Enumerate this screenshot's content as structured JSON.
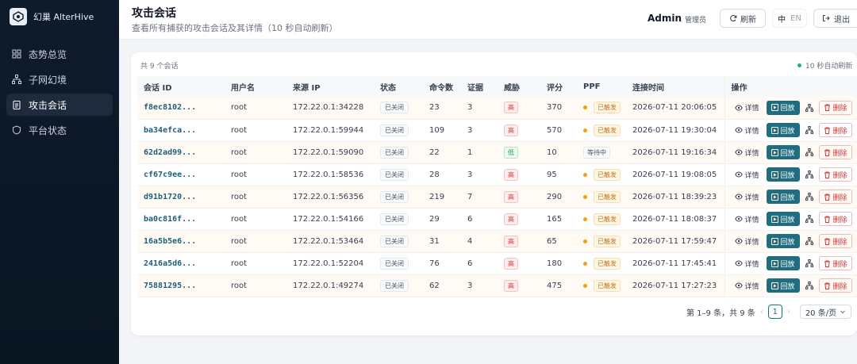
{
  "brand": {
    "name": "幻巢 AlterHive"
  },
  "sidebar": {
    "items": [
      {
        "label": "态势总览",
        "icon": "dashboard-icon",
        "active": false
      },
      {
        "label": "子网幻境",
        "icon": "network-icon",
        "active": false
      },
      {
        "label": "攻击会话",
        "icon": "clipboard-icon",
        "active": true
      },
      {
        "label": "平台状态",
        "icon": "shield-icon",
        "active": false
      }
    ]
  },
  "header": {
    "title": "攻击会话",
    "subtitle": "查看所有捕获的攻击会话及其详情（10 秒自动刷新）",
    "user": "Admin",
    "role": "管理员",
    "refresh_label": "刷新",
    "lang_zh": "中",
    "lang_en": "EN",
    "logout_label": "退出"
  },
  "card": {
    "total_label": "共 9 个会话",
    "auto_refresh_label": "10 秒自动刷新"
  },
  "table": {
    "columns": [
      "会话 ID",
      "用户名",
      "来源 IP",
      "状态",
      "命令数",
      "证据",
      "威胁",
      "评分",
      "PPF",
      "连接时间",
      "操作"
    ],
    "rows": [
      {
        "id": "f8ec8102...",
        "user": "root",
        "ip": "172.22.0.1:34228",
        "status": "已关闭",
        "cmds": "23",
        "evidence": "3",
        "threat": "高",
        "threat_level": "high",
        "score": "370",
        "ppf": "已触发",
        "ppf_state": "triggered",
        "time": "2026-07-11 20:06:05"
      },
      {
        "id": "ba34efca...",
        "user": "root",
        "ip": "172.22.0.1:59944",
        "status": "已关闭",
        "cmds": "109",
        "evidence": "3",
        "threat": "高",
        "threat_level": "high",
        "score": "570",
        "ppf": "已触发",
        "ppf_state": "triggered",
        "time": "2026-07-11 19:30:04"
      },
      {
        "id": "62d2ad99...",
        "user": "root",
        "ip": "172.22.0.1:59090",
        "status": "已关闭",
        "cmds": "22",
        "evidence": "1",
        "threat": "低",
        "threat_level": "low",
        "score": "10",
        "ppf": "等待中",
        "ppf_state": "waiting",
        "time": "2026-07-11 19:16:34"
      },
      {
        "id": "cf67c9ee...",
        "user": "root",
        "ip": "172.22.0.1:58536",
        "status": "已关闭",
        "cmds": "28",
        "evidence": "3",
        "threat": "高",
        "threat_level": "high",
        "score": "95",
        "ppf": "已触发",
        "ppf_state": "triggered",
        "time": "2026-07-11 19:08:05"
      },
      {
        "id": "d91b1720...",
        "user": "root",
        "ip": "172.22.0.1:56356",
        "status": "已关闭",
        "cmds": "219",
        "evidence": "7",
        "threat": "高",
        "threat_level": "high",
        "score": "290",
        "ppf": "已触发",
        "ppf_state": "triggered",
        "time": "2026-07-11 18:39:23"
      },
      {
        "id": "ba0c816f...",
        "user": "root",
        "ip": "172.22.0.1:54166",
        "status": "已关闭",
        "cmds": "29",
        "evidence": "6",
        "threat": "高",
        "threat_level": "high",
        "score": "165",
        "ppf": "已触发",
        "ppf_state": "triggered",
        "time": "2026-07-11 18:08:37"
      },
      {
        "id": "16a5b5e6...",
        "user": "root",
        "ip": "172.22.0.1:53464",
        "status": "已关闭",
        "cmds": "31",
        "evidence": "4",
        "threat": "高",
        "threat_level": "high",
        "score": "65",
        "ppf": "已触发",
        "ppf_state": "triggered",
        "time": "2026-07-11 17:59:47"
      },
      {
        "id": "2416a5d6...",
        "user": "root",
        "ip": "172.22.0.1:52204",
        "status": "已关闭",
        "cmds": "76",
        "evidence": "6",
        "threat": "高",
        "threat_level": "high",
        "score": "180",
        "ppf": "已触发",
        "ppf_state": "triggered",
        "time": "2026-07-11 17:45:41"
      },
      {
        "id": "75881295...",
        "user": "root",
        "ip": "172.22.0.1:49274",
        "status": "已关闭",
        "cmds": "62",
        "evidence": "3",
        "threat": "高",
        "threat_level": "high",
        "score": "475",
        "ppf": "已触发",
        "ppf_state": "triggered",
        "time": "2026-07-11 17:27:23"
      }
    ],
    "actions": {
      "detail": "详情",
      "replay": "回放",
      "delete": "删除"
    }
  },
  "pagination": {
    "summary": "第 1–9 条，共 9 条",
    "current_page": "1",
    "page_size": "20 条/页"
  },
  "colors": {
    "sidebar_bg": "#0e1b2b",
    "accent": "#1f6d7f",
    "danger": "#d93636",
    "success": "#10b981",
    "warning": "#f59e0b"
  }
}
